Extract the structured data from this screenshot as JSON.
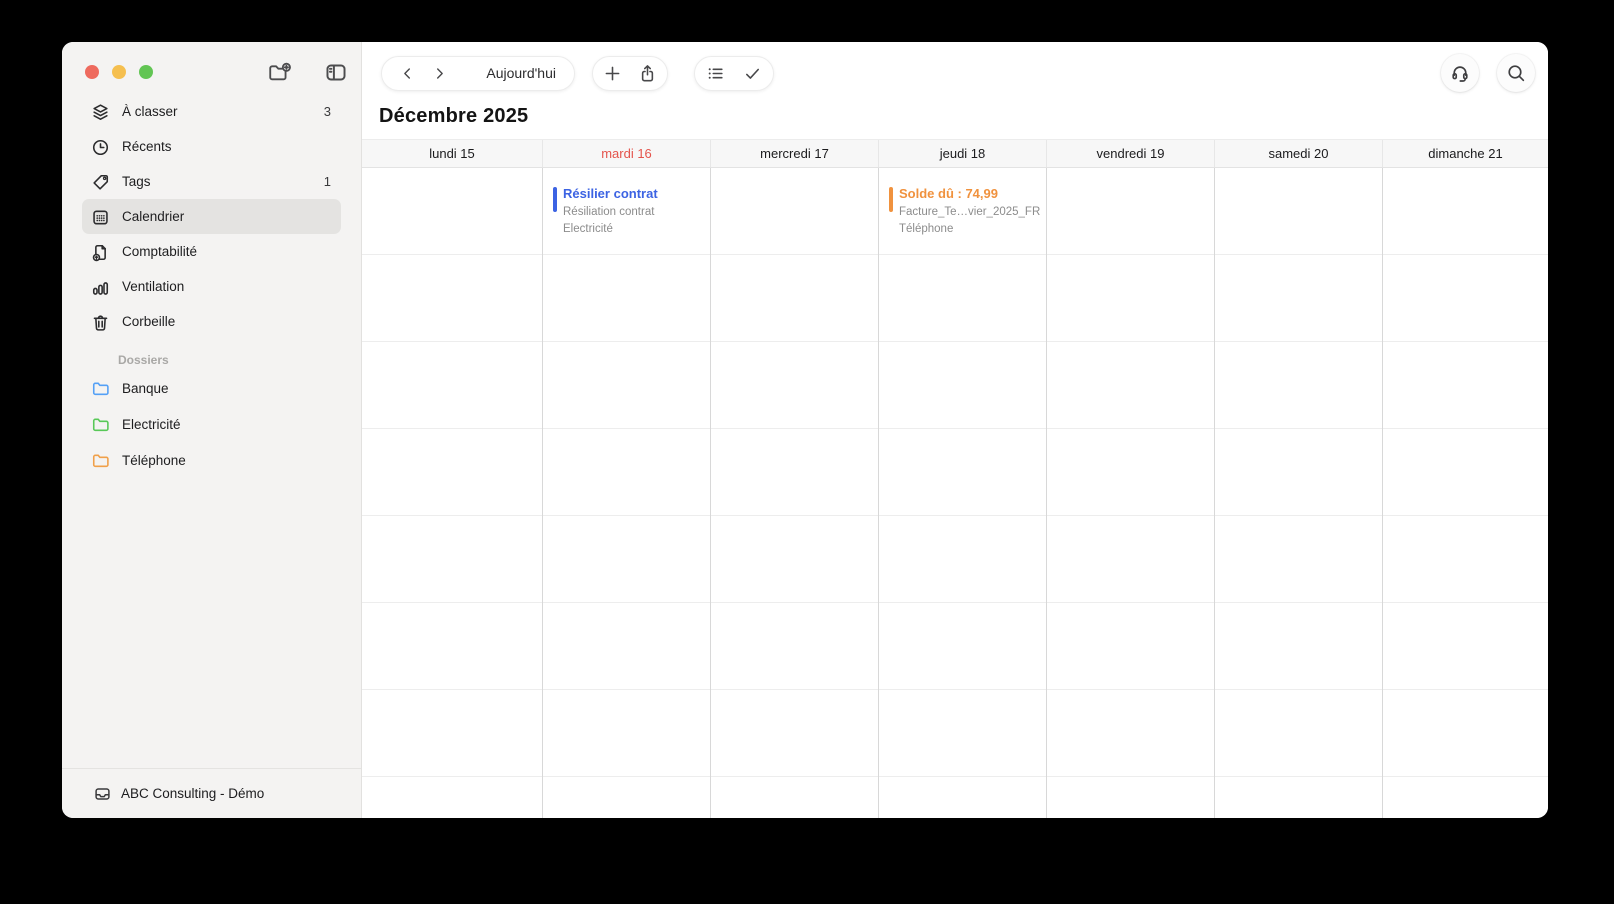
{
  "colors": {
    "traffic_red": "#ee6a5e",
    "traffic_yellow": "#f5bf4f",
    "traffic_green": "#62c554",
    "today_red": "#e4544c",
    "event_blue": "#3c63e3",
    "event_orange": "#f0923e"
  },
  "sidebar": {
    "items": [
      {
        "label": "À classer",
        "badge": "3"
      },
      {
        "label": "Récents",
        "badge": ""
      },
      {
        "label": "Tags",
        "badge": "1"
      },
      {
        "label": "Calendrier",
        "badge": ""
      },
      {
        "label": "Comptabilité",
        "badge": ""
      },
      {
        "label": "Ventilation",
        "badge": ""
      },
      {
        "label": "Corbeille",
        "badge": ""
      }
    ],
    "folders_header": "Dossiers",
    "folders": [
      {
        "label": "Banque",
        "color": "#54a0f6"
      },
      {
        "label": "Electricité",
        "color": "#58c858"
      },
      {
        "label": "Téléphone",
        "color": "#f0a04a"
      }
    ],
    "account_label": "ABC Consulting - Démo"
  },
  "toolbar": {
    "today_label": "Aujourd'hui"
  },
  "calendar": {
    "title": "Décembre 2025",
    "days": [
      {
        "label": "lundi 15"
      },
      {
        "label": "mardi 16"
      },
      {
        "label": "mercredi 17"
      },
      {
        "label": "jeudi 18"
      },
      {
        "label": "vendredi 19"
      },
      {
        "label": "samedi 20"
      },
      {
        "label": "dimanche 21"
      }
    ],
    "events": [
      {
        "day": "mardi 16",
        "title": "Résilier contrat",
        "subtitle1": "Résiliation contrat",
        "subtitle2": "Electricité",
        "color": "#3c63e3"
      },
      {
        "day": "jeudi 18",
        "title": "Solde dû : 74,99",
        "subtitle1": "Facture_Te…vier_2025_FR",
        "subtitle2": "Téléphone",
        "color": "#f0923e"
      }
    ]
  }
}
